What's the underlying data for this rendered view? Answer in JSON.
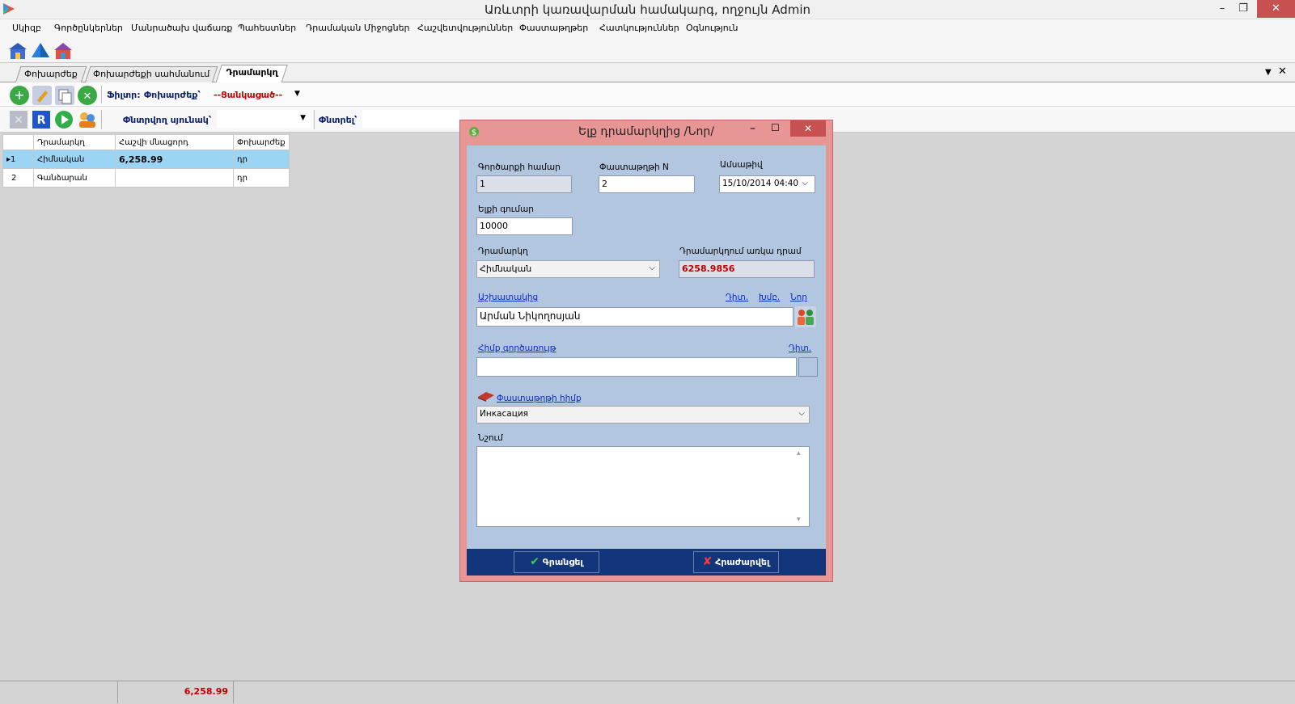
{
  "window": {
    "title": "Առևտրի կառավարման համակարգ, ողջույն Admin",
    "minimize": "–",
    "restore": "❐",
    "close": "✕"
  },
  "menu": [
    "Սկիզբ",
    "Գործընկերներ",
    "Մանրածախ վաճառք",
    "Պահեստներ",
    "Դրամական Միջոցներ",
    "Հաշվետվություններ",
    "Փաստաթղթեր",
    "Հատկություններ",
    "Օգնություն"
  ],
  "tabs": [
    "Փոխարժեք",
    "Փոխարժեքի սահմանում",
    "Դրամարկղ"
  ],
  "toolbar2": {
    "filter_label": "Ֆիլտր:",
    "filter_value": "Փոխարժեք՝",
    "filter_select": "--Ցանկացած--"
  },
  "toolbar3": {
    "search_column_label": "Փնտրվող սյունակ՝",
    "search_label": "Փնտրել՝"
  },
  "grid": {
    "columns": [
      "Դրամարկղ",
      "Հաշվի մնացորդ",
      "Փոխարժեք"
    ],
    "rows": [
      {
        "num": "1",
        "cashbox": "Հիմնական",
        "balance": "6,258.99",
        "currency": "դր"
      },
      {
        "num": "2",
        "cashbox": "Գանձարան",
        "balance": "",
        "currency": "դր"
      }
    ]
  },
  "dialog": {
    "title": "Ելք դրամարկղից /Նոր/",
    "doc_number_label": "Գործարքի համար",
    "doc_number": "1",
    "doc_n_label": "Փաստաթղթի N",
    "doc_n": "2",
    "date_label": "Ամսաթիվ",
    "date": "15/10/2014 04:40",
    "amount_label": "Ելքի գումար",
    "amount": "10000",
    "cashbox_label": "Դրամարկղ",
    "cashbox": "Հիմնական",
    "available_label": "Դրամարկղում առկա դրամ",
    "available": "6258.9856",
    "employee_label": "Աշխատակից",
    "employee_links": [
      "Դիտ.",
      "Խմբ.",
      "Նոր"
    ],
    "employee": "Արման Նիկողոսյան",
    "payment_label": "Հիմք գործառույթ",
    "payment_link": "Դիտ.",
    "payment": "",
    "doc_basis_link": "Փաստաթղթի հիմք",
    "doc_basis": "Инкасация",
    "note_label": "Նշում",
    "note": "",
    "save_btn": "Գրանցել",
    "cancel_btn": "Հրաժարվել"
  },
  "status": {
    "total": "6,258.99"
  },
  "colors": {
    "dialog_border": "#e79595",
    "dialog_body": "#b3c6e0",
    "dialog_footer": "#12357b",
    "grid_selected": "#9cd4f4",
    "link": "#0a2cc7",
    "red_value": "#c00000"
  }
}
